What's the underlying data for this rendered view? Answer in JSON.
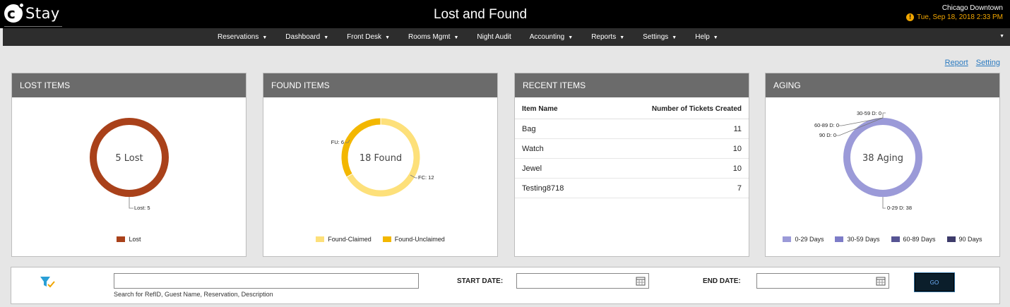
{
  "app": {
    "logo_text": "Stay"
  },
  "header": {
    "title": "Lost and Found",
    "hotel_name": "Chicago Downtown",
    "datetime": "Tue, Sep 18, 2018 2:33 PM",
    "warning_icon": "exclamation-circle-icon"
  },
  "nav": {
    "items": [
      {
        "label": "Reservations",
        "has_dropdown": true
      },
      {
        "label": "Dashboard",
        "has_dropdown": true
      },
      {
        "label": "Front Desk",
        "has_dropdown": true
      },
      {
        "label": "Rooms Mgmt",
        "has_dropdown": true
      },
      {
        "label": "Night Audit",
        "has_dropdown": false
      },
      {
        "label": "Accounting",
        "has_dropdown": true
      },
      {
        "label": "Reports",
        "has_dropdown": true
      },
      {
        "label": "Settings",
        "has_dropdown": true
      },
      {
        "label": "Help",
        "has_dropdown": true
      }
    ]
  },
  "links": {
    "report": "Report",
    "setting": "Setting"
  },
  "lost_items": {
    "title": "LOST ITEMS",
    "center_label": "5 Lost",
    "legend": [
      {
        "label": "Lost",
        "color": "#a9411a"
      }
    ]
  },
  "found_items": {
    "title": "FOUND ITEMS",
    "center_label": "18 Found",
    "legend": [
      {
        "label": "Found-Claimed",
        "color": "#fde07a"
      },
      {
        "label": "Found-Unclaimed",
        "color": "#f3b700"
      }
    ]
  },
  "recent_items": {
    "title": "RECENT ITEMS",
    "columns": [
      "Item Name",
      "Number of Tickets Created"
    ],
    "rows": [
      {
        "name": "Bag",
        "count": "11"
      },
      {
        "name": "Watch",
        "count": "10"
      },
      {
        "name": "Jewel",
        "count": "10"
      },
      {
        "name": "Testing8718",
        "count": "7"
      }
    ]
  },
  "aging": {
    "title": "AGING",
    "center_label": "38 Aging",
    "legend": [
      {
        "label": "0-29 Days",
        "color": "#9b9ad8"
      },
      {
        "label": "30-59 Days",
        "color": "#7d7cc8"
      },
      {
        "label": "60-89 Days",
        "color": "#565494"
      },
      {
        "label": "90 Days",
        "color": "#3d3b6a"
      }
    ]
  },
  "chart_data": [
    {
      "type": "pie",
      "title": "LOST ITEMS",
      "categories": [
        "Lost"
      ],
      "values": [
        5
      ],
      "data_labels": [
        "Lost: 5"
      ],
      "colors": [
        "#a9411a"
      ],
      "donut": true
    },
    {
      "type": "pie",
      "title": "FOUND ITEMS",
      "categories": [
        "Found-Claimed",
        "Found-Unclaimed"
      ],
      "values": [
        12,
        6
      ],
      "data_labels": [
        "FC: 12",
        "FU: 6"
      ],
      "colors": [
        "#fde07a",
        "#f3b700"
      ],
      "donut": true
    },
    {
      "type": "pie",
      "title": "AGING",
      "categories": [
        "0-29 Days",
        "30-59 Days",
        "60-89 Days",
        "90 Days"
      ],
      "values": [
        38,
        0,
        0,
        0
      ],
      "data_labels": [
        "0-29 D: 38",
        "30-59 D: 0",
        "60-89 D: 0",
        "90 D: 0"
      ],
      "colors": [
        "#9b9ad8",
        "#7d7cc8",
        "#565494",
        "#3d3b6a"
      ],
      "donut": true
    }
  ],
  "search": {
    "placeholder": "",
    "hint": "Search for RefID, Guest Name, Reservation, Description",
    "start_label": "START DATE:",
    "end_label": "END DATE:",
    "go_label": "GO",
    "filter_icon": "filter-check-icon",
    "calendar_icon": "calendar-icon"
  }
}
